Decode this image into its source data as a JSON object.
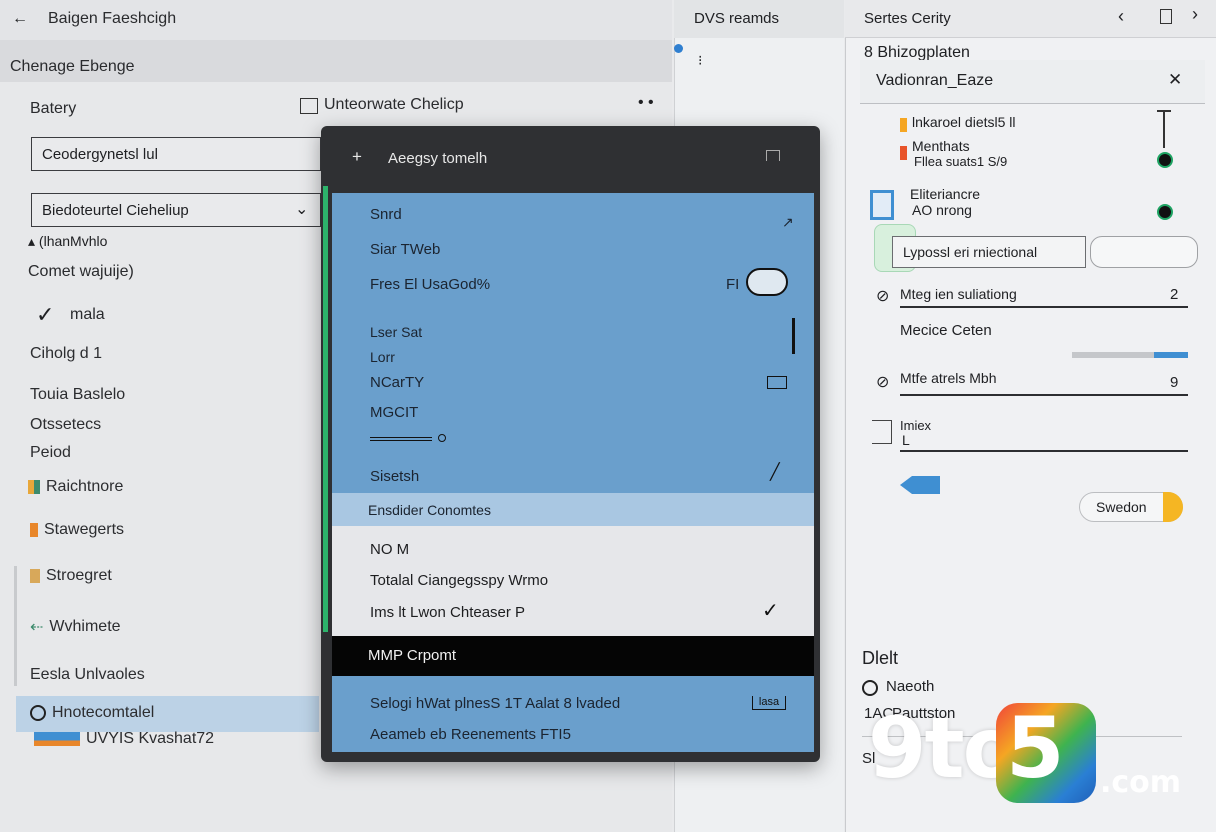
{
  "left": {
    "header_title": "Baigen Faeshcigh",
    "sub_title": "Chenage Ebenge",
    "label_battery": "Batery",
    "toolbar_item": "Unteorwate Chelicp",
    "field1_value": "Ceodergynetsl lul",
    "dropdown_value": "Biedoteurtel Cieheliup",
    "caret_label": "(lhanMvhlo",
    "connect_label": "Comet wajuije)",
    "mala_label": "mala",
    "items": [
      "Ciholg d 1",
      "Touia Baslelo",
      "Otssetecs",
      "Peiod",
      "Raichtnore",
      "Stawegerts",
      "Stroegret",
      "Wvhimete",
      "Eesla Unlvaoles",
      "Hnotecomtalel",
      "UVYIS Kvashat72"
    ]
  },
  "middle": {
    "title": "DVS reamds"
  },
  "right": {
    "title": "Sertes Cerity",
    "section_title": "8 Bhizogplaten",
    "dialog_title": "Vadionran_Eaze",
    "row1_line1": "lnkaroel dietsl5 ll",
    "row2_line1": "Menthats",
    "row2_line2": "Fllea suats1 S/9",
    "row3_line1": "Eliteriancre",
    "row3_line2": "AO nrong",
    "button_label": "Lypossl eri rniectional",
    "slider1_label": "Mteg ien suliationg",
    "slider1_value": "2",
    "mode_label": "Mecice Ceten",
    "slider2_label": "Mtfe atrels Mbh",
    "slider2_value": "9",
    "slider3_label": "Imiex",
    "slider3_sub": "L",
    "pill_label": "Swedon",
    "bottom_title": "Dlelt",
    "bottom_item1": "Naeoth",
    "bottom_item2": "Pauttston",
    "bottom_item3": "Sl"
  },
  "popup": {
    "title": "Aeegsy tomelh",
    "items": [
      "Snrd",
      "Siar TWeb",
      "Fres El UsaGod%",
      "Lser Sat",
      "Lorr",
      "NCarTY",
      "MGCIT",
      "Sisetsh"
    ],
    "toggle_prefix": "FI",
    "highlight_item": "Ensdider Conomtes",
    "white_items": [
      "NO M",
      "Totalal Ciangegsspy Wrmo",
      "Ims lt Lwon Chteaser P"
    ],
    "black_item": "MMP Crpomt",
    "bottom_items": [
      "Selogi hWat plnesS 1T Aalat 8 lvaded",
      "Aeameb eb Reenements FTI5"
    ],
    "bottom_badge": "lasa"
  },
  "watermark": {
    "digit_left": "9",
    "middle": "to",
    "digit_right": "5",
    "suffix": ".com"
  },
  "colors": {
    "menu_blue": "#6a9fcc",
    "menu_highlight": "#a9c7e2",
    "popup_frame": "#2f3033",
    "accent_green": "#2db36b",
    "accent_orange": "#f5a623",
    "accent_blue": "#3f8fd2"
  }
}
